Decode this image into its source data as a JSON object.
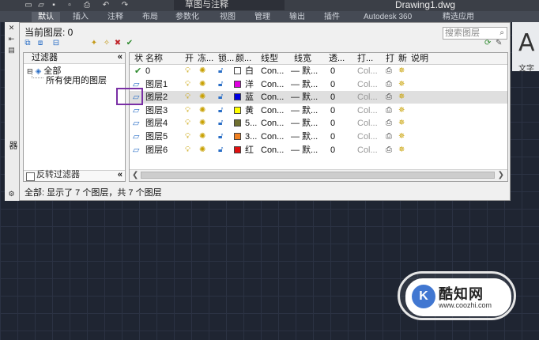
{
  "app": {
    "workspace": "草图与注释",
    "file_title": "Drawing1.dwg",
    "ribbon_tabs": [
      "默认",
      "插入",
      "注释",
      "布局",
      "参数化",
      "视图",
      "管理",
      "输出",
      "插件",
      "Autodesk 360",
      "精选应用"
    ],
    "ribbon_panel": {
      "glyph": "A",
      "label": "文字"
    }
  },
  "palette": {
    "title": "图层特性管理器",
    "current_layer": "当前图层: 0",
    "search_placeholder": "搜索图层",
    "filter_pane": {
      "header": "过滤器",
      "tree_root": "全部",
      "tree_child": "所有使用的图层",
      "invert_label": "反转过滤器"
    },
    "columns": [
      "状",
      "名称",
      "开",
      "冻...",
      "锁...",
      "颜...",
      "线型",
      "线宽",
      "透...",
      "打...",
      "打",
      "新",
      "说明"
    ],
    "layers": [
      {
        "status": "current",
        "name": "0",
        "color_hex": "#ffffff",
        "color_name": "白",
        "linetype": "Con...",
        "lineweight": "— 默...",
        "transparency": "0",
        "plot_style": "Col..."
      },
      {
        "status": "",
        "name": "图层1",
        "color_hex": "#e000e0",
        "color_name": "洋",
        "linetype": "Con...",
        "lineweight": "— 默...",
        "transparency": "0",
        "plot_style": "Col..."
      },
      {
        "status": "",
        "name": "图层2",
        "color_hex": "#0000e0",
        "color_name": "蓝",
        "linetype": "Con...",
        "lineweight": "— 默...",
        "transparency": "0",
        "plot_style": "Col..."
      },
      {
        "status": "",
        "name": "图层3",
        "color_hex": "#ffff00",
        "color_name": "黄",
        "linetype": "Con...",
        "lineweight": "— 默...",
        "transparency": "0",
        "plot_style": "Col..."
      },
      {
        "status": "",
        "name": "图层4",
        "color_hex": "#707030",
        "color_name": "5...",
        "linetype": "Con...",
        "lineweight": "— 默...",
        "transparency": "0",
        "plot_style": "Col..."
      },
      {
        "status": "",
        "name": "图层5",
        "color_hex": "#f08020",
        "color_name": "3...",
        "linetype": "Con...",
        "lineweight": "— 默...",
        "transparency": "0",
        "plot_style": "Col..."
      },
      {
        "status": "",
        "name": "图层6",
        "color_hex": "#e01010",
        "color_name": "红",
        "linetype": "Con...",
        "lineweight": "— 默...",
        "transparency": "0",
        "plot_style": "Col..."
      }
    ],
    "selected_row": 2,
    "status_text": "全部: 显示了 7 个图层，共 7 个图层"
  },
  "watermark": {
    "logo": "K",
    "name": "酷知网",
    "url": "www.coozhi.com"
  }
}
